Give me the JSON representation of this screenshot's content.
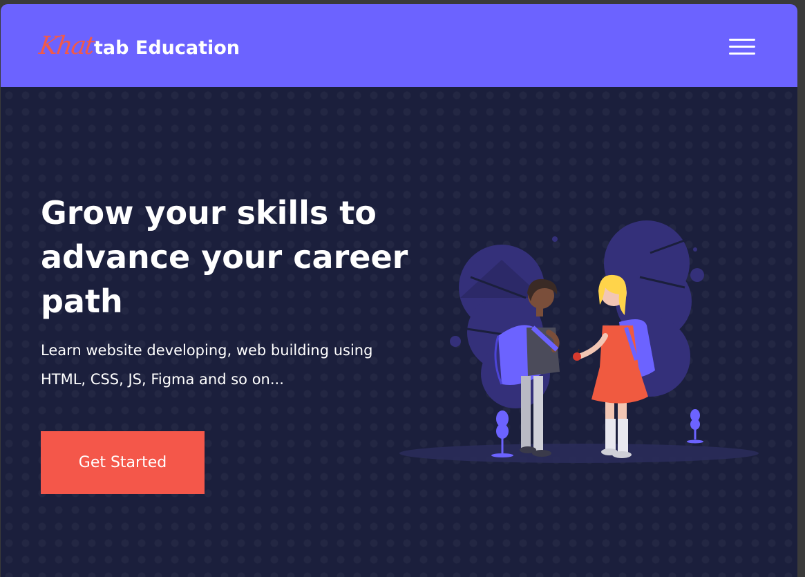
{
  "brand": {
    "logo_script": "Khat",
    "logo_rest": "tab Education"
  },
  "nav": {
    "menu_icon": "hamburger-menu-icon"
  },
  "hero": {
    "headline": "Grow your skills to advance your career path",
    "subtext": "Learn website developing, web building using HTML, CSS, JS, Figma and so on...",
    "cta_label": "Get Started"
  },
  "colors": {
    "navbar": "#6c63ff",
    "hero_bg": "#1b1f3c",
    "accent": "#f4574a",
    "text": "#ffffff"
  },
  "illustration": {
    "icon": "students-with-backpacks-illustration"
  }
}
